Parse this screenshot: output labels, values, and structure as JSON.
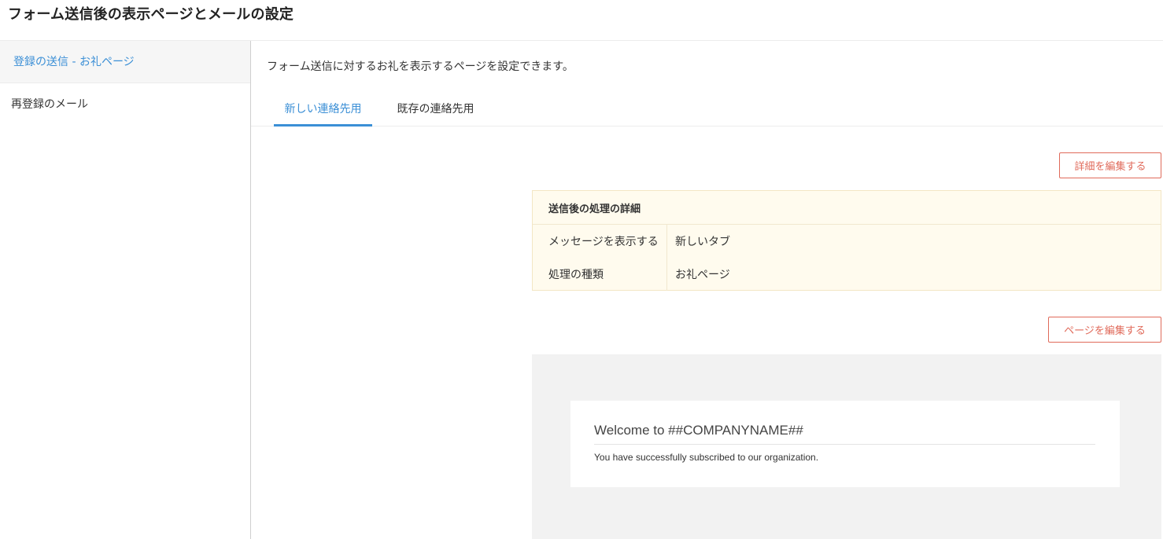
{
  "header": {
    "title": "フォーム送信後の表示ページとメールの設定"
  },
  "sidebar": {
    "items": [
      {
        "label": "登録の送信 - お礼ページ"
      },
      {
        "label": "再登録のメール"
      }
    ]
  },
  "main": {
    "description": "フォーム送信に対するお礼を表示するページを設定できます。",
    "tabs": [
      {
        "label": "新しい連絡先用"
      },
      {
        "label": "既存の連絡先用"
      }
    ],
    "edit_details_label": "詳細を編集する",
    "details": {
      "title": "送信後の処理の詳細",
      "rows": [
        {
          "label": "メッセージを表示する",
          "value": "新しいタブ"
        },
        {
          "label": "処理の種類",
          "value": "お礼ページ"
        }
      ]
    },
    "edit_page_label": "ページを編集する",
    "preview": {
      "heading": "Welcome to ##COMPANYNAME##",
      "text": "You have successfully subscribed to our organization."
    }
  },
  "colors": {
    "accent_blue": "#3b8fd6",
    "button_red": "#e06a5a",
    "details_bg": "#fffbee",
    "preview_bg": "#f2f2f2"
  }
}
